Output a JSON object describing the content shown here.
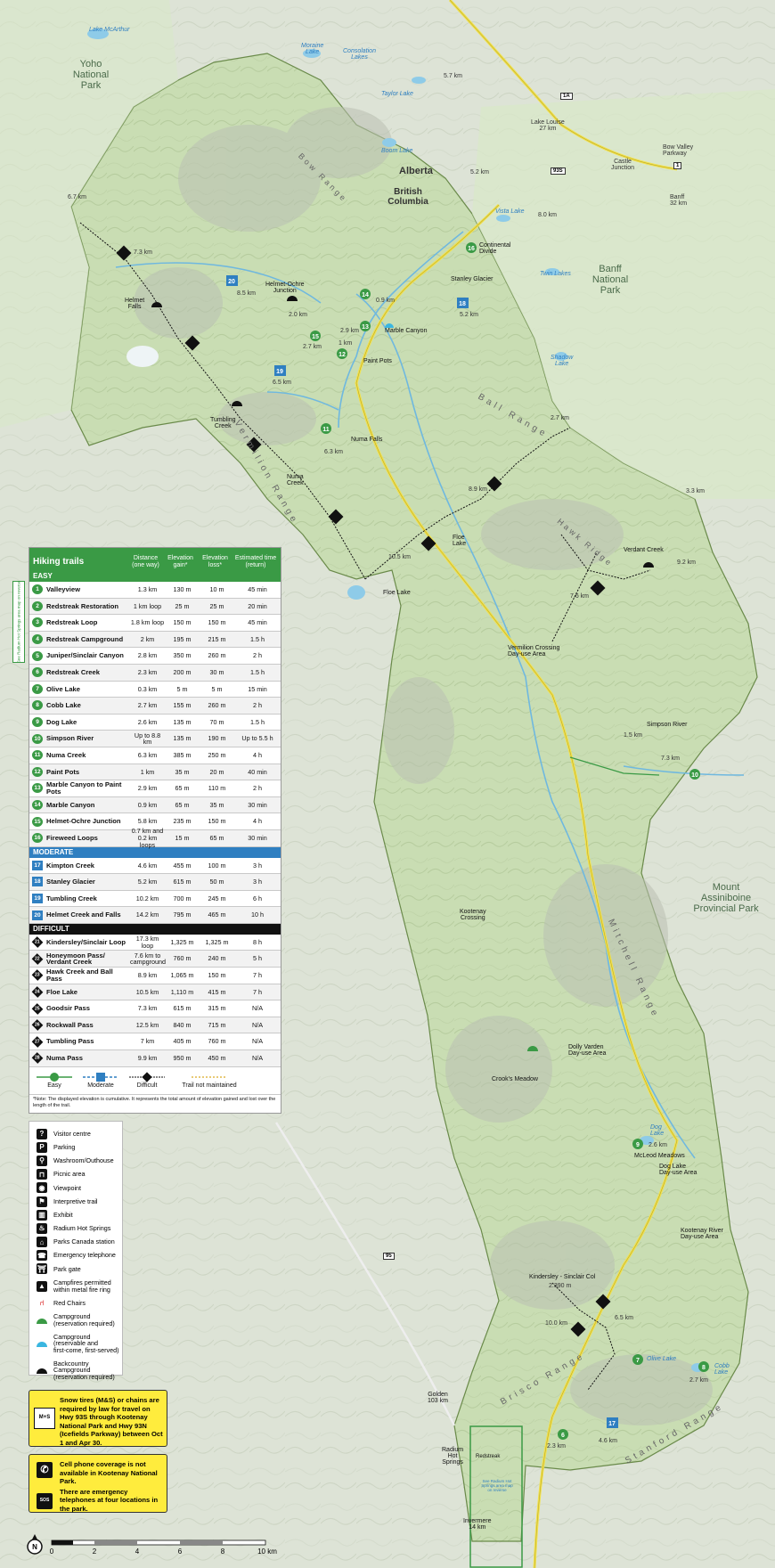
{
  "map": {
    "region_labels": {
      "yoho": "Yoho\nNational\nPark",
      "banff": "Banff\nNational\nPark",
      "assiniboine": "Mount\nAssiniboine\nProvincial Park",
      "alberta": "Alberta",
      "bc": "British\nColumbia"
    },
    "ranges": [
      "Vermilion Range",
      "Ball Range",
      "Mitchell Range",
      "Brisco Range",
      "Stanford Range",
      "Hawk Ridge",
      "Bow Range"
    ],
    "places": {
      "lake_mcarthur": "Lake McArthur",
      "moraine_lake": "Moraine\nLake",
      "consolation": "Consolation\nLakes",
      "taylor_lake": "Taylor Lake",
      "boom_lake": "Boom Lake",
      "vista_lake": "Vista Lake",
      "twin_lakes": "Twin Lakes",
      "shadow_lake": "Shadow\nLake",
      "lake_louise": "Lake Louise\n27 km",
      "castle": "Castle\nJunction",
      "bow_valley": "Bow Valley\nParkway",
      "banff_dist": "Banff\n32 km",
      "continental": "Continental\nDivide",
      "stanley_glacier": "Stanley Glacier",
      "marble_canyon": "Marble Canyon",
      "paint_pots": "Paint Pots",
      "helmet_ochre": "Helmet-Ochre\nJunction",
      "helmet_falls": "Helmet\nFalls",
      "numa_falls": "Numa Falls",
      "tumbling_creek": "Tumbling\nCreek",
      "numa_creek": "Numa\nCreek",
      "floe_lake": "Floe Lake",
      "floe_lake2": "Floe\nLake",
      "vermilion_crossing": "Vermilion Crossing\nDay-use Area",
      "verdant_creek": "Verdant Creek",
      "simpson_river": "Simpson River",
      "kootenay_crossing": "Kootenay\nCrossing",
      "dolly_varden": "Dolly Varden\nDay-use Area",
      "crooks_meadow": "Crook's Meadow",
      "dog_lake": "Dog\nLake",
      "mcleod_meadows": "McLeod Meadows",
      "dog_lake_day": "Dog Lake\nDay-use Area",
      "kootenay_river": "Kootenay River\nDay-use Area",
      "kindersley_col": "Kindersley - Sinclair Col",
      "olive_lake": "Olive Lake",
      "cobb_lake": "Cobb\nLake",
      "radium": "Radium\nHot\nSprings",
      "redstreak": "Redstreak",
      "golden": "Golden\n103 km",
      "invermere": "Invermere\n14 km",
      "see_radium": "See Radium Hot\nSprings area map\non reverse"
    },
    "distances": [
      "5.7 km",
      "5.2 km",
      "8.0 km",
      "6.7 km",
      "7.3 km",
      "8.5 km",
      "2.0 km",
      "0.9 km",
      "2.9 km",
      "2.7 km",
      "1 km",
      "5.2 km",
      "6.5 km",
      "6.3 km",
      "2.7 km",
      "8.9 km",
      "3.3 km",
      "10.5 km",
      "7.6 km",
      "9.2 km",
      "1.5 km",
      "7.3 km",
      "2.6 km",
      "10.0 km",
      "6.5 km",
      "2.7 km",
      "2.3 km",
      "4.6 km",
      "2.390 m"
    ],
    "highways": [
      "1A",
      "1",
      "93S",
      "95"
    ]
  },
  "trails": {
    "title": "Hiking trails",
    "columns": [
      "Distance\n(one way)",
      "Elevation\ngain*",
      "Elevation\nloss*",
      "Estimated time\n(return)"
    ],
    "sections": [
      {
        "name": "EASY",
        "kind": "easy",
        "rows": [
          {
            "n": "1",
            "name": "Valleyview",
            "dist": "1.3 km",
            "gain": "130 m",
            "loss": "10 m",
            "time": "45 min"
          },
          {
            "n": "2",
            "name": "Redstreak Restoration",
            "dist": "1 km loop",
            "gain": "25 m",
            "loss": "25 m",
            "time": "20 min"
          },
          {
            "n": "3",
            "name": "Redstreak Loop",
            "dist": "1.8 km loop",
            "gain": "150 m",
            "loss": "150 m",
            "time": "45 min"
          },
          {
            "n": "4",
            "name": "Redstreak Campground",
            "dist": "2 km",
            "gain": "195 m",
            "loss": "215 m",
            "time": "1.5 h"
          },
          {
            "n": "5",
            "name": "Juniper/Sinclair Canyon",
            "dist": "2.8 km",
            "gain": "350 m",
            "loss": "260 m",
            "time": "2 h"
          },
          {
            "n": "6",
            "name": "Redstreak Creek",
            "dist": "2.3 km",
            "gain": "200 m",
            "loss": "30 m",
            "time": "1.5 h"
          },
          {
            "n": "7",
            "name": "Olive Lake",
            "dist": "0.3 km",
            "gain": "5 m",
            "loss": "5 m",
            "time": "15 min"
          },
          {
            "n": "8",
            "name": "Cobb Lake",
            "dist": "2.7 km",
            "gain": "155 m",
            "loss": "260 m",
            "time": "2 h"
          },
          {
            "n": "9",
            "name": "Dog Lake",
            "dist": "2.6 km",
            "gain": "135 m",
            "loss": "70 m",
            "time": "1.5 h"
          },
          {
            "n": "10",
            "name": "Simpson River",
            "dist": "Up to 8.8 km",
            "gain": "135 m",
            "loss": "190 m",
            "time": "Up to 5.5 h"
          },
          {
            "n": "11",
            "name": "Numa Creek",
            "dist": "6.3 km",
            "gain": "385 m",
            "loss": "250 m",
            "time": "4 h"
          },
          {
            "n": "12",
            "name": "Paint Pots",
            "dist": "1 km",
            "gain": "35 m",
            "loss": "20 m",
            "time": "40 min"
          },
          {
            "n": "13",
            "name": "Marble Canyon to Paint Pots",
            "dist": "2.9 km",
            "gain": "65 m",
            "loss": "110 m",
            "time": "2 h"
          },
          {
            "n": "14",
            "name": "Marble Canyon",
            "dist": "0.9 km",
            "gain": "65 m",
            "loss": "35 m",
            "time": "30 min"
          },
          {
            "n": "15",
            "name": "Helmet-Ochre Junction",
            "dist": "5.8 km",
            "gain": "235 m",
            "loss": "150 m",
            "time": "4 h"
          },
          {
            "n": "16",
            "name": "Fireweed Loops",
            "dist": "0.7 km and 0.2 km loops",
            "gain": "15 m",
            "loss": "65 m",
            "time": "30 min"
          }
        ]
      },
      {
        "name": "MODERATE",
        "kind": "mod",
        "rows": [
          {
            "n": "17",
            "name": "Kimpton Creek",
            "dist": "4.6 km",
            "gain": "455 m",
            "loss": "100 m",
            "time": "3 h"
          },
          {
            "n": "18",
            "name": "Stanley Glacier",
            "dist": "5.2 km",
            "gain": "615 m",
            "loss": "50 m",
            "time": "3 h"
          },
          {
            "n": "19",
            "name": "Tumbling Creek",
            "dist": "10.2 km",
            "gain": "700 m",
            "loss": "245 m",
            "time": "6 h"
          },
          {
            "n": "20",
            "name": "Helmet Creek and Falls",
            "dist": "14.2 km",
            "gain": "795 m",
            "loss": "465 m",
            "time": "10 h"
          }
        ]
      },
      {
        "name": "DIFFICULT",
        "kind": "diff",
        "rows": [
          {
            "n": "21",
            "name": "Kindersley/Sinclair Loop",
            "dist": "17.3 km loop",
            "gain": "1,325 m",
            "loss": "1,325 m",
            "time": "8 h"
          },
          {
            "n": "22",
            "name": "Honeymoon Pass/ Verdant Creek",
            "dist": "7.6 km to campground",
            "gain": "760 m",
            "loss": "240 m",
            "time": "5 h"
          },
          {
            "n": "23",
            "name": "Hawk Creek and Ball Pass",
            "dist": "8.9 km",
            "gain": "1,065 m",
            "loss": "150 m",
            "time": "7 h"
          },
          {
            "n": "24",
            "name": "Floe Lake",
            "dist": "10.5 km",
            "gain": "1,110 m",
            "loss": "415 m",
            "time": "7 h"
          },
          {
            "n": "25",
            "name": "Goodsir Pass",
            "dist": "7.3 km",
            "gain": "615 m",
            "loss": "315 m",
            "time": "N/A"
          },
          {
            "n": "26",
            "name": "Rockwall Pass",
            "dist": "12.5 km",
            "gain": "840 m",
            "loss": "715 m",
            "time": "N/A"
          },
          {
            "n": "27",
            "name": "Tumbling Pass",
            "dist": "7 km",
            "gain": "405 m",
            "loss": "760 m",
            "time": "N/A"
          },
          {
            "n": "28",
            "name": "Numa Pass",
            "dist": "9.9 km",
            "gain": "950 m",
            "loss": "450 m",
            "time": "N/A"
          }
        ]
      }
    ],
    "difficulty_legend": [
      "Easy",
      "Moderate",
      "Difficult",
      "Trail not maintained"
    ],
    "note": "*Note: The displayed elevation is cumulative. It represents the total amount of elevation gained and lost over the length of the trail."
  },
  "legend": {
    "items": [
      {
        "icon": "visitor-centre-icon",
        "glyph": "?",
        "label": "Visitor centre"
      },
      {
        "icon": "parking-icon",
        "glyph": "P",
        "label": "Parking"
      },
      {
        "icon": "washroom-icon",
        "glyph": "⚲",
        "label": "Washroom/Outhouse"
      },
      {
        "icon": "picnic-icon",
        "glyph": "⊓",
        "label": "Picnic area"
      },
      {
        "icon": "viewpoint-icon",
        "glyph": "◉",
        "label": "Viewpoint"
      },
      {
        "icon": "interpretive-trail-icon",
        "glyph": "⚑",
        "label": "Interpretive trail"
      },
      {
        "icon": "exhibit-icon",
        "glyph": "▥",
        "label": "Exhibit"
      },
      {
        "icon": "hot-springs-icon",
        "glyph": "♨",
        "label": "Radium Hot Springs"
      },
      {
        "icon": "parks-station-icon",
        "glyph": "⌂",
        "label": "Parks Canada station"
      },
      {
        "icon": "emergency-phone-icon",
        "glyph": "☎",
        "label": "Emergency telephone"
      },
      {
        "icon": "park-gate-icon",
        "glyph": "⛩",
        "label": "Park gate"
      },
      {
        "icon": "campfire-icon",
        "glyph": "▲",
        "label": "Campfires permitted\nwithin metal fire ring"
      },
      {
        "icon": "red-chairs-icon",
        "glyph": "⑁",
        "label": "Red Chairs"
      },
      {
        "icon": "campground-icon",
        "glyph": "",
        "label": "Campground\n(reservation required)"
      },
      {
        "icon": "campground-first-come-icon",
        "glyph": "",
        "label": "Campground\n(reservable and\nfirst-come, first-served)"
      },
      {
        "icon": "backcountry-campground-icon",
        "glyph": "",
        "label": "Backcountry\nCampground\n(reservation required)"
      }
    ]
  },
  "notices": {
    "tires": "Snow tires (M&S) or chains are required by law for travel on Hwy 93S through Kootenay National Park and Hwy 93N (Icefields Parkway) between Oct 1 and Apr 30.",
    "tires_badge": "M+S",
    "cell": "Cell phone coverage is not available in Kootenay National Park.",
    "phones": "There are emergency telephones at four locations in the park.",
    "sos_badge": "SOS"
  },
  "sidetab": "See Radium Hot Springs area map on reverse",
  "scale": {
    "ticks": [
      "0",
      "2",
      "4",
      "6",
      "8",
      "10 km"
    ],
    "north": "N"
  },
  "colors": {
    "easy": "#3a9a45",
    "moderate": "#2f7fc1",
    "difficult": "#111111",
    "park": "#c6dcb0",
    "water": "#8ecbe8",
    "road": "#f2e24a"
  }
}
